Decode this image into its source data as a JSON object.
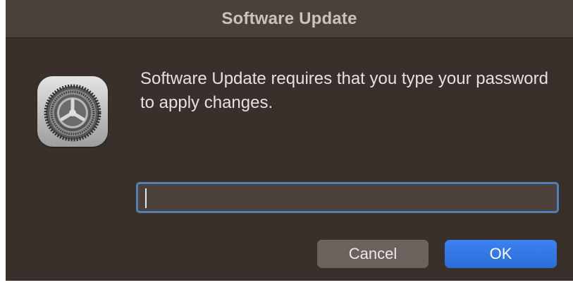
{
  "dialog": {
    "title": "Software Update",
    "message": "Software Update requires that you type your password to apply changes.",
    "icon": "system-preferences-gear-icon",
    "password_field": {
      "value": "",
      "placeholder": ""
    },
    "buttons": {
      "cancel_label": "Cancel",
      "ok_label": "OK"
    }
  },
  "colors": {
    "background": "#3a302b",
    "titlebar": "#4a413b",
    "accent": "#2f74e4",
    "field_border": "#4f7fb3"
  }
}
